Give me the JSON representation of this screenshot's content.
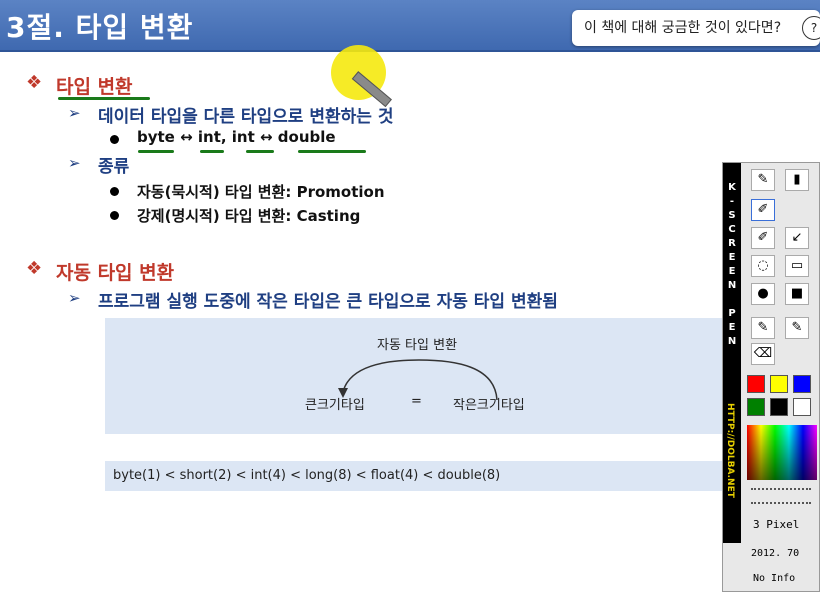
{
  "header": {
    "title": "3절. 타입 변환",
    "question_button": "이 책에 대해 궁금한 것이 있다면?",
    "question_icon": "?"
  },
  "section1": {
    "bullet": "❖",
    "heading": "타입 변환",
    "arrow": "➢",
    "definition": "데이터 타입을 다른 타입으로 변환하는 것",
    "examples": "byte ↔ int,    int ↔ double",
    "kinds_heading": "종류",
    "kind1": "자동(묵시적) 타입 변환: Promotion",
    "kind2": "강제(명시적) 타입 변환: Casting"
  },
  "section2": {
    "bullet": "❖",
    "heading": "자동 타입 변환",
    "arrow": "➢",
    "description": "프로그램 실행 도중에 작은 타입은 큰 타입으로 자동 타입 변환됨",
    "diagram": {
      "caption": "자동 타입 변환",
      "left": "큰크기타입",
      "equals": "=",
      "right": "작은크기타입"
    },
    "order": "byte(1) < short(2) < int(4) < long(8) < float(4) < double(8)"
  },
  "kpen": {
    "side_letters": [
      "K",
      "-",
      "S",
      "C",
      "R",
      "E",
      "E",
      "N",
      "",
      "P",
      "E",
      "N"
    ],
    "url": "HTTP://DOLBA.NET",
    "pixel_size": "3 Pixel",
    "version": "2012. 70",
    "info": "No Info",
    "colors": [
      "#ff0000",
      "#ffff00",
      "#0000ff",
      "#008000",
      "#000000",
      "#ffffff"
    ]
  }
}
